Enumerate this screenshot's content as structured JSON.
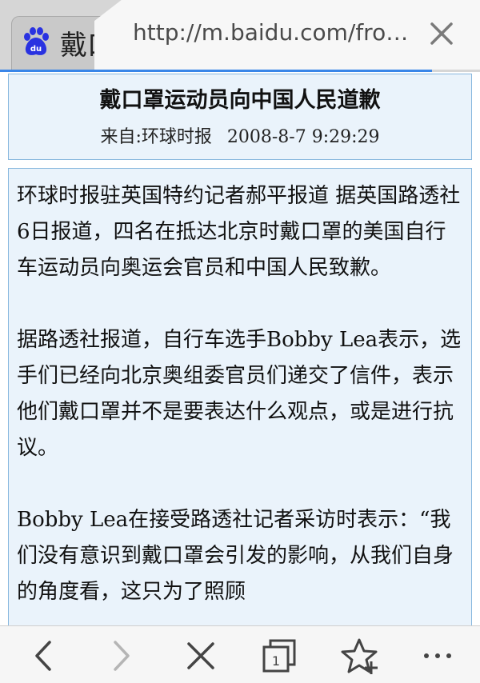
{
  "tab": {
    "title": "戴口",
    "logo_text": "du"
  },
  "urlbar": {
    "url": "http://m.baidu.com/fro…"
  },
  "article": {
    "title": "戴口罩运动员向中国人民道歉",
    "source": "来自:环球时报",
    "date": "2008-8-7 9:29:29",
    "paragraphs": [
      "环球时报驻英国特约记者郝平报道 据英国路透社6日报道，四名在抵达北京时戴口罩的美国自行车运动员向奥运会官员和中国人民致歉。",
      "  据路透社报道，自行车选手Bobby Lea表示，选手们已经向北京奥组委官员们递交了信件，表示他们戴口罩并不是要表达什么观点，或是进行抗议。",
      "  Bobby Lea在接受路透社记者采访时表示：“我们没有意识到戴口罩会引发的影响，从我们自身的角度看，这只为了照顾"
    ]
  },
  "toolbar": {
    "tab_count": "1"
  },
  "colors": {
    "accent": "#3a86e8",
    "box_border": "#88b8de",
    "box_bg": "#eaf3fb",
    "baidu_blue": "#2932e1"
  }
}
